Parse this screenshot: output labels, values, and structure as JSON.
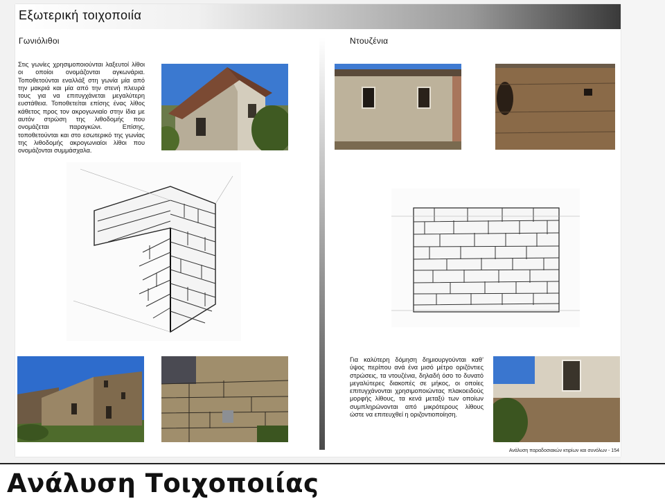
{
  "document": {
    "title": "Εξωτερική τοιχοποιία",
    "footer": "Ανάλυση παραδοσιακών κτιρίων και συνόλων - 154"
  },
  "left_section": {
    "heading": "Γωνιόλιθοι",
    "paragraph": "Στις γωνίες χρησιμοποιούνται λαξευτοί λίθοι οι οποίοι ονομάζονται αγκωνάρια. Τοποθετούνται εναλλάξ στη γωνία μία από την μακριά και μία από την στενή πλευρά τους για να επιτυγχάνεται μεγαλύτερη ευστάθεια. Τοποθετείται επίσης ένας λίθος κάθετος προς τον ακρογωνιαίο στην ίδια με αυτόν στρώση της λιθοδομής που ονομάζεται παραγκώνι. Επίσης, τοποθετούνται και στο εσωτερικό της γωνίας της λιθοδομής ακρογωνιαίοι λίθοι που ονομάζονται συμμάσχαλα."
  },
  "right_section": {
    "heading": "Ντουζένια",
    "paragraph": "Για καλύτερη δόμηση δημιουργούνται καθ’ ύψος περίπου ανά ένα μισό μέτρο οριζόντιες στρώσεις, τα ντουζένια, δηλαδή όσο το δυνατό μεγαλύτερες διακοπές σε μήκος, οι οποίες επιτυγχάνονται χρησιμοποιώντας πλακοειδούς μορφής λίθους, τα κενά μεταξύ των οποίων συμπληρώνονται από μικρότερους λίθους ώστε να επιτευχθεί η οριζοντιοποίηση."
  },
  "slide": {
    "title": "Ανάλυση  Τοιχοποιίας"
  },
  "colors": {
    "sky": "#2f6fc9",
    "stone_light": "#c9bfa8",
    "stone_dark": "#8a7a5e",
    "roof": "#7a4a32",
    "foliage": "#4f6b2a"
  }
}
